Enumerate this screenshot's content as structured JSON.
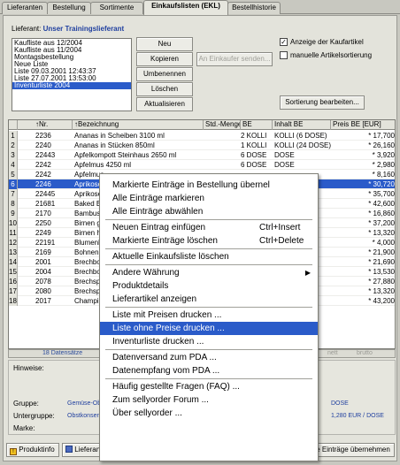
{
  "tabs": [
    "Lieferanten",
    "Bestellung",
    "Sortimente",
    "Einkaufslisten (EKL)",
    "Bestellhistorie"
  ],
  "supplier": {
    "label": "Lieferant:",
    "name": "Unser Trainingslieferant"
  },
  "lists": [
    "Kaufliste aus 12/2004",
    "Kaufliste aus 11/2004",
    "Montagsbestellung",
    "Neue Liste",
    "Liste 09.03.2001 12:43:37",
    "Liste 27.07.2001 13:53:00",
    "Inventurliste 2004"
  ],
  "buttons": {
    "new": "Neu",
    "copy": "Kopieren",
    "send": "An Einkaufer senden...",
    "rename": "Umbenennen",
    "delete": "Löschen",
    "refresh": "Aktualisieren",
    "sort": "Sortierung bearbeiten..."
  },
  "checks": {
    "show_articles": "Anzeige der Kaufartikel",
    "manual_sort": "manuelle Artikelsortierung"
  },
  "columns": [
    "↑Nr.",
    "↑Bezeichnung",
    "Std.-Menge",
    "BE",
    "Inhalt BE",
    "Preis BE [EUR]"
  ],
  "rows": [
    {
      "n": "1",
      "nr": "2236",
      "bez": "Ananas in Scheiben   3100 ml",
      "menge": "",
      "be": "2 KOLLI",
      "inhalt": "KOLLI (6 DOSE)",
      "preis": "* 17,700"
    },
    {
      "n": "2",
      "nr": "2240",
      "bez": "Ananas in Stücken          850ml",
      "menge": "",
      "be": "1 KOLLI",
      "inhalt": "KOLLI (24 DOSE)",
      "preis": "* 26,160"
    },
    {
      "n": "3",
      "nr": "22443",
      "bez": "Apfelkompott Steinhaus   2650 ml",
      "menge": "",
      "be": "6 DOSE",
      "inhalt": "DOSE",
      "preis": "* 3,920"
    },
    {
      "n": "4",
      "nr": "2242",
      "bez": "Apfelmus          4250 ml",
      "menge": "",
      "be": "6 DOSE",
      "inhalt": "DOSE",
      "preis": "* 2,980"
    },
    {
      "n": "5",
      "nr": "2242",
      "bez": "Apfelmus",
      "menge": "",
      "be": "",
      "inhalt": "",
      "preis": "* 8,160"
    },
    {
      "n": "6",
      "nr": "2246",
      "bez": "Aprikose",
      "menge": "",
      "be": "",
      "inhalt": "",
      "preis": "* 30,720"
    },
    {
      "n": "7",
      "nr": "22445",
      "bez": "Aprikose",
      "menge": "",
      "be": "",
      "inhalt": "",
      "preis": "* 35,700"
    },
    {
      "n": "8",
      "nr": "21681",
      "bez": "Baked B",
      "menge": "",
      "be": "",
      "inhalt": "",
      "preis": "* 42,600"
    },
    {
      "n": "9",
      "nr": "2170",
      "bez": "Bambus",
      "menge": "",
      "be": "",
      "inhalt": "",
      "preis": "* 16,860"
    },
    {
      "n": "10",
      "nr": "2250",
      "bez": "Birnen g",
      "menge": "",
      "be": "",
      "inhalt": "",
      "preis": "* 37,200"
    },
    {
      "n": "11",
      "nr": "2249",
      "bez": "Birnen h",
      "menge": "",
      "be": "",
      "inhalt": "",
      "preis": "* 13,320"
    },
    {
      "n": "12",
      "nr": "22191",
      "bez": "Blumenk",
      "menge": "",
      "be": "",
      "inhalt": "",
      "preis": "* 4,000"
    },
    {
      "n": "13",
      "nr": "2169",
      "bez": "Bohnenk",
      "menge": "",
      "be": "",
      "inhalt": "",
      "preis": "* 21,900"
    },
    {
      "n": "14",
      "nr": "2001",
      "bez": "Brechbo",
      "menge": "",
      "be": "",
      "inhalt": "",
      "preis": "* 21,690"
    },
    {
      "n": "15",
      "nr": "2004",
      "bez": "Brechbo",
      "menge": "",
      "be": "",
      "inhalt": "",
      "preis": "* 13,530"
    },
    {
      "n": "16",
      "nr": "2078",
      "bez": "Brechsp",
      "menge": "",
      "be": "",
      "inhalt": "",
      "preis": "* 27,880"
    },
    {
      "n": "17",
      "nr": "2080",
      "bez": "Brechsp",
      "menge": "",
      "be": "",
      "inhalt": "",
      "preis": "* 13,320"
    },
    {
      "n": "18",
      "nr": "2017",
      "bez": "Champig",
      "menge": "",
      "be": "",
      "inhalt": "",
      "preis": "* 43,200"
    }
  ],
  "status": {
    "count": "18 Datensätze",
    "page_a": "nett",
    "page_b": "brutto"
  },
  "details": {
    "hints_label": "Hinweise:",
    "group_label": "Gruppe:",
    "group_value": "Gemüse-Ob",
    "subgroup_label": "Untergruppe:",
    "subgroup_value": "Obstkonser",
    "brand_label": "Marke:",
    "unit_value": "DOSE",
    "price_value": "1,280 EUR / DOSE"
  },
  "bottom": {
    "productinfo": "Produktinfo",
    "supplier_btn": "Lieferan",
    "accept": "e Einträge übernehmen"
  },
  "menu": [
    {
      "label": "Markierte Einträge in Bestellung übernel"
    },
    {
      "label": "Alle Einträge markieren"
    },
    {
      "label": "Alle Einträge abwählen"
    },
    {
      "sep": true
    },
    {
      "label": "Neuen Eintrag einfügen",
      "shortcut": "Ctrl+Insert"
    },
    {
      "label": "Markierte Einträge löschen",
      "shortcut": "Ctrl+Delete"
    },
    {
      "sep": true
    },
    {
      "label": "Aktuelle Einkaufsliste löschen"
    },
    {
      "sep": true
    },
    {
      "label": "Andere Währung",
      "submenu": true
    },
    {
      "label": "Produktdetails"
    },
    {
      "label": "Lieferartikel anzeigen"
    },
    {
      "sep": true
    },
    {
      "label": "Liste mit Preisen drucken ..."
    },
    {
      "label": "Liste ohne Preise drucken ...",
      "highlight": true
    },
    {
      "label": "Inventurliste drucken ..."
    },
    {
      "sep": true
    },
    {
      "label": "Datenversand zum PDA ..."
    },
    {
      "label": "Datenempfang vom PDA ..."
    },
    {
      "sep": true
    },
    {
      "label": "Häufig gestellte Fragen (FAQ) ..."
    },
    {
      "label": "Zum sellyorder Forum ..."
    },
    {
      "label": "Über sellyorder ..."
    }
  ]
}
